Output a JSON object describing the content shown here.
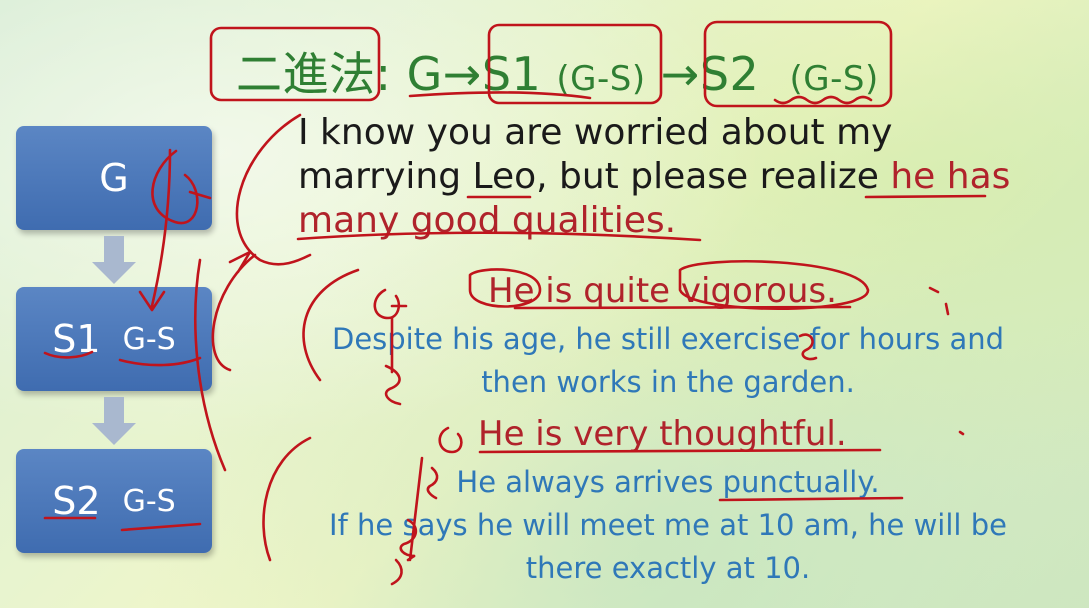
{
  "title": {
    "method": "二進法",
    "colon": ":",
    "g": "G",
    "arrow": "→",
    "s1": "S1",
    "s1_gs": "(G-S)",
    "s2": "S2",
    "s2_gs": "(G-S)"
  },
  "boxes": {
    "g": "G",
    "s1": "S1",
    "s1_gs": "G-S",
    "s2": "S2",
    "s2_gs": "G-S"
  },
  "main": {
    "line1": "I know you are worried about my",
    "line2_a": "marrying Leo, but please realize ",
    "line2_b": "he has",
    "line3": "many good qualities."
  },
  "s1_block": {
    "heading": "He is quite vigorous.",
    "support_line1": "Despite his age, he still exercise for hours and",
    "support_line2": "then works in the garden."
  },
  "s2_block": {
    "heading": "He is very thoughtful.",
    "support_line1": "He always arrives punctually.",
    "support_line2": "If he says he will meet me at 10 am, he will be",
    "support_line3": "there exactly at 10."
  },
  "colors": {
    "title_green": "#2f7f33",
    "box_blue": "#4a78bb",
    "accent_red": "#b0232b",
    "support_blue": "#2f78b8",
    "ink_red": "#c0141c"
  }
}
